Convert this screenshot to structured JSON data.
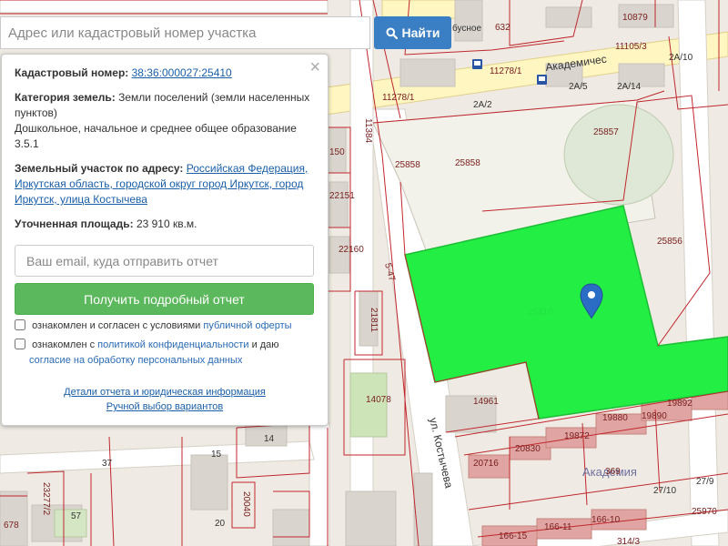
{
  "search": {
    "placeholder": "Адрес или кадастровый номер участка",
    "button_label": "Найти"
  },
  "panel": {
    "cadastral_label": "Кадастровый номер:",
    "cadastral_number": "38:36:000027:25410",
    "category_label": "Категория земель:",
    "category_value": "Земли поселений (земли населенных пунктов)",
    "usage_value": "Дошкольное, начальное и среднее общее образование 3.5.1",
    "address_label": "Земельный участок по адресу:",
    "address_value": "Российская Федерация, Иркутская область, городской округ город Иркутск, город Иркутск, улица Костычева",
    "area_label": "Уточненная площадь:",
    "area_value": "23 910 кв.м.",
    "email_placeholder": "Ваш email, куда отправить отчет",
    "report_button": "Получить подробный отчет",
    "offer_text": "ознакомлен и согласен с условиями",
    "offer_link": "публичной оферты",
    "privacy_text": "ознакомлен с",
    "privacy_link": "политикой конфиденциальности",
    "privacy_and": "и даю",
    "consent_link": "согласие на обработку персональных данных",
    "details_link": "Детали отчета и юридическая информация",
    "manual_link": "Ручной выбор вариантов"
  },
  "map": {
    "highlight_color": "#22ee44",
    "parcel_line_color": "#c0272d",
    "marker_color": "#2b6cc4",
    "labels": {
      "p10879": "10879",
      "p632": "632",
      "p11105": "11105/3",
      "p2a10": "2А/10",
      "p11278_1": "11278/1",
      "p2a5": "2А/5",
      "p2a14": "2А/14",
      "p11278_1b": "11278/1",
      "p2a2": "2А/2",
      "p11384": "11384",
      "p25857": "25857",
      "p25858a": "25858",
      "p25858b": "25858",
      "p150": "150",
      "p22151": "22151",
      "p22160": "22160",
      "p25856": "25856",
      "p21811": "21811",
      "p14078": "14078",
      "p14961": "14961",
      "p19892": "19892",
      "p19880": "19880",
      "p19890": "19890",
      "p19872": "19872",
      "p20830": "20830",
      "p20716": "20716",
      "p369": "369",
      "p27_10": "27/10",
      "p27_9": "27/9",
      "p25970": "25970",
      "p14": "14",
      "p15": "15",
      "p37": "37",
      "p20": "20",
      "p20040": "20040",
      "p23277": "23277/2",
      "p678": "678",
      "p57": "57",
      "p166_15": "166-15",
      "p166_11": "166-11",
      "p166_10": "166-10",
      "p314_3": "314/3",
      "p547": "5-47"
    },
    "street_kostycheva": "ул. Костычева",
    "street_akadem": "Академичес",
    "district_label": "Академия",
    "stop_label": "бусное",
    "faded_label": "25410"
  }
}
